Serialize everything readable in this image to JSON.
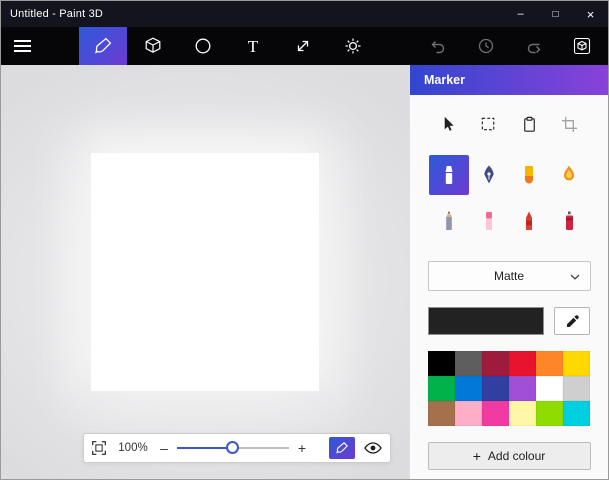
{
  "window": {
    "title": "Untitled - Paint 3D",
    "controls": {
      "minimize": "–",
      "maximize": "□",
      "close": "×"
    }
  },
  "accent": {
    "blue": "#2d59d8",
    "purple": "#6d3bd2"
  },
  "toolbar": {
    "tools": [
      {
        "name": "brushes",
        "selected": true
      },
      {
        "name": "3d-shapes",
        "selected": false
      },
      {
        "name": "2d-shapes",
        "selected": false
      },
      {
        "name": "text",
        "selected": false
      },
      {
        "name": "canvas",
        "selected": false
      },
      {
        "name": "effects",
        "selected": false
      }
    ],
    "text_tool_glyph": "T",
    "history_buttons": [
      "undo",
      "history",
      "redo"
    ],
    "library": "3d-library"
  },
  "panel": {
    "header": "Marker",
    "select_tools": [
      "select",
      "marquee-select",
      "paste",
      "crop"
    ],
    "brushes": [
      "marker",
      "calligraphy-pen",
      "oil-brush",
      "watercolour",
      "pencil",
      "eraser",
      "crayon",
      "spray-can"
    ],
    "selected_brush": "marker",
    "finish": {
      "value": "Matte"
    },
    "current_colour": "#222222",
    "palette": [
      "#000000",
      "#5e5e5e",
      "#9e1b3c",
      "#e8132c",
      "#ff8628",
      "#ffd800",
      "#00b24a",
      "#0079d8",
      "#303fa0",
      "#a14fd6",
      "#ffffff",
      "#cfcfcf",
      "#a5714d",
      "#ffaec8",
      "#f23ba2",
      "#fff7a8",
      "#8fdc00",
      "#00cfe0"
    ],
    "add_colour_plus": "+",
    "add_colour_label": "Add colour"
  },
  "zoombar": {
    "zoom_value": "100%",
    "minus_glyph": "–",
    "plus_glyph": "+",
    "slider_percent": 50
  },
  "icons": {
    "menu-icon": "hamburger",
    "brush-icon": "paintbrush",
    "cube-icon": "3d cube",
    "circle-icon": "2d shape circle",
    "resize-icon": "canvas diagonal arrows",
    "sun-icon": "effects sun",
    "undo-icon": "curved arrow left",
    "history-icon": "clock",
    "redo-icon": "curved arrow right",
    "3d-library-icon": "boxed cube",
    "cursor-icon": "selection arrow",
    "marquee-icon": "dashed rectangle",
    "paste-icon": "clipboard",
    "crop-icon": "crop corners",
    "chevron-down-icon": "dropdown chevron",
    "eyedropper-icon": "colour picker dropper",
    "fit-view-icon": "fit to screen frame",
    "eye-icon": "view mode eye"
  }
}
